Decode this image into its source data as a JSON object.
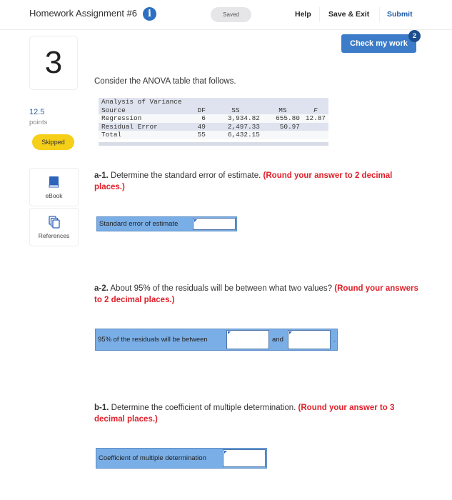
{
  "header": {
    "title": "Homework Assignment #6",
    "info_icon": "info-icon",
    "saved_status": "Saved",
    "nav": {
      "help": "Help",
      "save_exit": "Save & Exit",
      "submit": "Submit"
    },
    "check_my_work": "Check my work",
    "check_badge": "2"
  },
  "question": {
    "number": "3",
    "points": "12.5",
    "points_label": "points",
    "status": "Skipped"
  },
  "tools": [
    {
      "label": "eBook",
      "icon": "book-icon"
    },
    {
      "label": "References",
      "icon": "copy-documents-icon"
    }
  ],
  "prompt": "Consider the ANOVA table that follows.",
  "anova": {
    "title": "Analysis of Variance",
    "headers": [
      "Source",
      "DF",
      "SS",
      "MS",
      "F"
    ],
    "rows": [
      [
        "Regression",
        "6",
        "3,934.82",
        "655.80",
        "12.87"
      ],
      [
        "Residual Error",
        "49",
        "2,497.33",
        "50.97",
        ""
      ],
      [
        "Total",
        "55",
        "6,432.15",
        "",
        ""
      ]
    ]
  },
  "parts": [
    {
      "lead": "a-1.",
      "text": "Determine the standard error of estimate.",
      "instruction": "(Round your answer to 2 decimal places.)",
      "answer_label": "Standard error of estimate",
      "value": ""
    },
    {
      "lead": "a-2.",
      "text": "About 95% of the residuals will be between what two values?",
      "instruction": "(Round your answers to 2 decimal places.)",
      "answer_label": "95% of the residuals will be between",
      "joiner": "and",
      "terminator": ".",
      "value_low": "",
      "value_high": ""
    },
    {
      "lead": "b-1.",
      "text": "Determine the coefficient of multiple determination.",
      "instruction": "(Round your answer to 3 decimal places.)",
      "answer_label": "Coefficient of multiple determination",
      "value": ""
    }
  ],
  "colors": {
    "accent": "#3c7cc9",
    "badge": "#1c4e8e",
    "skipped": "#f5cf18",
    "instruction_red": "#e0202a",
    "answer_row": "#7aaee6"
  }
}
